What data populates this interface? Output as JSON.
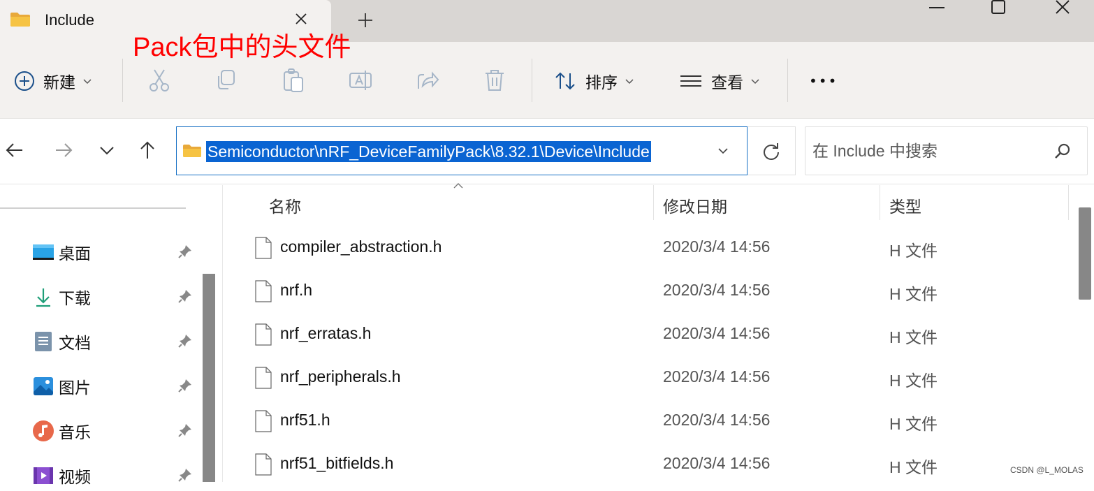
{
  "tab": {
    "title": "Include",
    "new_tab": "+"
  },
  "annotation": "Pack包中的头文件",
  "toolbar": {
    "new_label": "新建",
    "sort_label": "排序",
    "view_label": "查看",
    "more_label": "•••"
  },
  "address": {
    "path": "Semiconductor\\nRF_DeviceFamilyPack\\8.32.1\\Device\\Include"
  },
  "search": {
    "placeholder": "在 Include 中搜索"
  },
  "sidebar": {
    "items": [
      {
        "label": "桌面",
        "icon": "desktop-icon"
      },
      {
        "label": "下载",
        "icon": "download-icon"
      },
      {
        "label": "文档",
        "icon": "documents-icon"
      },
      {
        "label": "图片",
        "icon": "pictures-icon"
      },
      {
        "label": "音乐",
        "icon": "music-icon"
      },
      {
        "label": "视频",
        "icon": "videos-icon"
      }
    ]
  },
  "filelist": {
    "columns": {
      "name": "名称",
      "date": "修改日期",
      "type": "类型"
    },
    "rows": [
      {
        "name": "compiler_abstraction.h",
        "date": "2020/3/4 14:56",
        "type": "H 文件"
      },
      {
        "name": "nrf.h",
        "date": "2020/3/4 14:56",
        "type": "H 文件"
      },
      {
        "name": "nrf_erratas.h",
        "date": "2020/3/4 14:56",
        "type": "H 文件"
      },
      {
        "name": "nrf_peripherals.h",
        "date": "2020/3/4 14:56",
        "type": "H 文件"
      },
      {
        "name": "nrf51.h",
        "date": "2020/3/4 14:56",
        "type": "H 文件"
      },
      {
        "name": "nrf51_bitfields.h",
        "date": "2020/3/4 14:56",
        "type": "H 文件"
      }
    ]
  },
  "watermark": "CSDN @L_MOLAS",
  "colors": {
    "accent": "#1670c4",
    "selection": "#0a64d2",
    "annotation": "#ff0000",
    "folder": "#f6c343"
  }
}
